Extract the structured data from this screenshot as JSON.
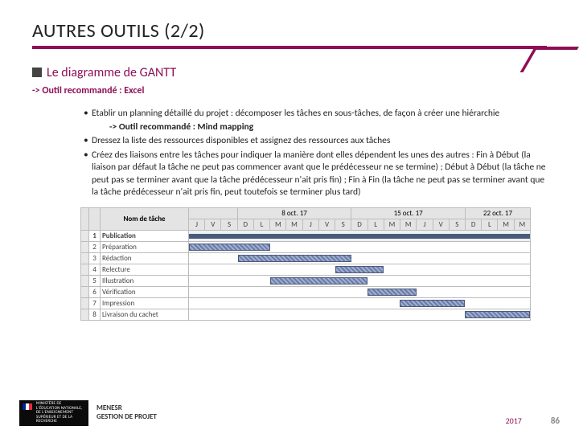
{
  "header": {
    "title": "AUTRES OUTILS (2/2)"
  },
  "section": {
    "title": "Le diagramme de GANTT",
    "subtitle": "-> Outil recommandé : Excel",
    "bullets": [
      {
        "text": "Etablir un planning détaillé du projet : décomposer les tâches en sous-tâches, de façon à créer une hiérarchie",
        "sub": "-> Outil recommandé : Mind mapping"
      },
      {
        "text": "Dressez la liste des ressources disponibles et assignez des ressources aux tâches"
      },
      {
        "text": "Créez des liaisons entre les tâches pour indiquer la manière dont elles dépendent les unes des autres : Fin à Début (la liaison par défaut la tâche ne peut pas commencer avant que le prédécesseur ne se termine) ; Début à Début (la tâche ne peut pas se terminer avant que la tâche prédécesseur n'ait pris fin) ; Fin à Fin (la tâche ne peut pas se terminer avant que la tâche prédécesseur n'ait pris fin, peut toutefois se terminer plus tard)"
      }
    ]
  },
  "gantt": {
    "name_col": "Nom de tâche",
    "weeks": [
      "8 oct. 17",
      "15 oct. 17",
      "22 oct. 17"
    ],
    "days": [
      "J",
      "V",
      "S",
      "D",
      "L",
      "M",
      "M",
      "J",
      "V",
      "S",
      "D",
      "L",
      "M",
      "M",
      "J",
      "V",
      "S",
      "D",
      "L",
      "M",
      "M"
    ],
    "rows": [
      {
        "n": "1",
        "name": "Publication",
        "type": "group",
        "start": 0,
        "len": 21
      },
      {
        "n": "2",
        "name": "Préparation",
        "start": 0,
        "len": 5
      },
      {
        "n": "3",
        "name": "Rédaction",
        "start": 3,
        "len": 7
      },
      {
        "n": "4",
        "name": "Relecture",
        "start": 9,
        "len": 3
      },
      {
        "n": "5",
        "name": "Illustration",
        "start": 5,
        "len": 6
      },
      {
        "n": "6",
        "name": "Vérification",
        "start": 11,
        "len": 3
      },
      {
        "n": "7",
        "name": "Impression",
        "start": 13,
        "len": 4
      },
      {
        "n": "8",
        "name": "Livraison du cachet",
        "start": 17,
        "len": 4
      }
    ]
  },
  "footer": {
    "ministry_label": "MINISTÈRE DE L'ÉDUCATION NATIONALE, DE L'ENSEIGNEMENT SUPÉRIEUR ET DE LA RECHERCHE",
    "org1": "MENESR",
    "org2": "GESTION DE PROJET",
    "year": "2017",
    "page": "86"
  }
}
